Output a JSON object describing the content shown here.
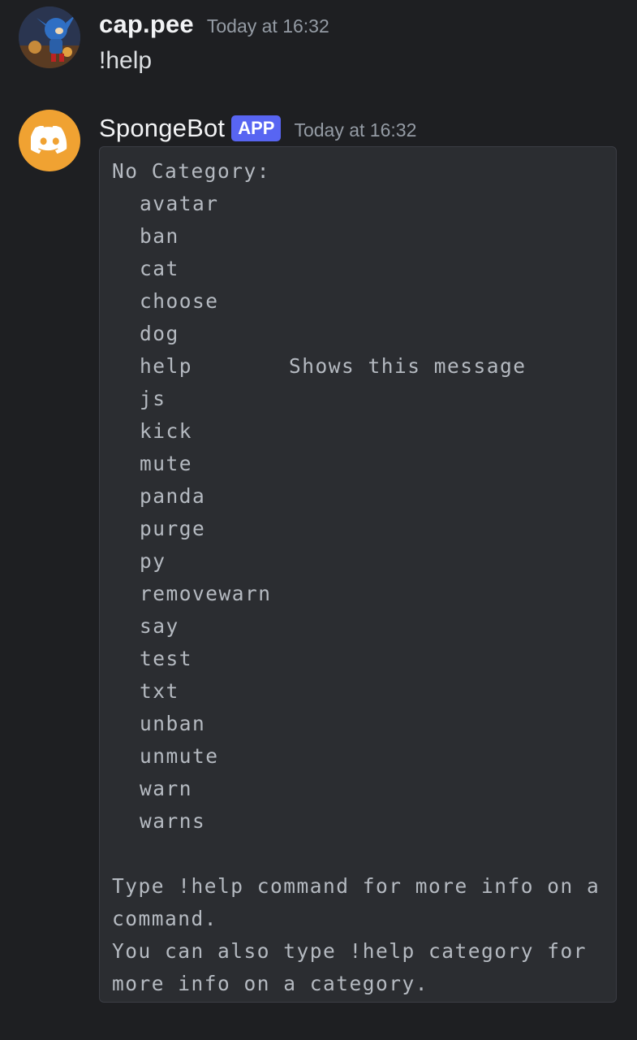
{
  "messages": [
    {
      "author": "cap.pee",
      "timestamp": "Today at 16:32",
      "text": "!help"
    },
    {
      "author": "SpongeBot",
      "badge": "APP",
      "timestamp": "Today at 16:32",
      "codeblock": {
        "category": "No Category:",
        "commands": [
          {
            "name": "avatar",
            "desc": ""
          },
          {
            "name": "ban",
            "desc": ""
          },
          {
            "name": "cat",
            "desc": ""
          },
          {
            "name": "choose",
            "desc": ""
          },
          {
            "name": "dog",
            "desc": ""
          },
          {
            "name": "help",
            "desc": "Shows this message"
          },
          {
            "name": "js",
            "desc": ""
          },
          {
            "name": "kick",
            "desc": ""
          },
          {
            "name": "mute",
            "desc": ""
          },
          {
            "name": "panda",
            "desc": ""
          },
          {
            "name": "purge",
            "desc": ""
          },
          {
            "name": "py",
            "desc": ""
          },
          {
            "name": "removewarn",
            "desc": ""
          },
          {
            "name": "say",
            "desc": ""
          },
          {
            "name": "test",
            "desc": ""
          },
          {
            "name": "txt",
            "desc": ""
          },
          {
            "name": "unban",
            "desc": ""
          },
          {
            "name": "unmute",
            "desc": ""
          },
          {
            "name": "warn",
            "desc": ""
          },
          {
            "name": "warns",
            "desc": ""
          }
        ],
        "footer": [
          "Type !help command for more info on a",
          "command.",
          "You can also type !help category for",
          "more info on a category."
        ]
      }
    }
  ],
  "icons": {
    "user_avatar": "user-avatar-image",
    "bot_avatar": "discord-logo-icon"
  },
  "colors": {
    "background": "#1e1f22",
    "codeblock_bg": "#2b2d31",
    "app_badge": "#5865f2",
    "bot_avatar_bg": "#f0a232"
  }
}
